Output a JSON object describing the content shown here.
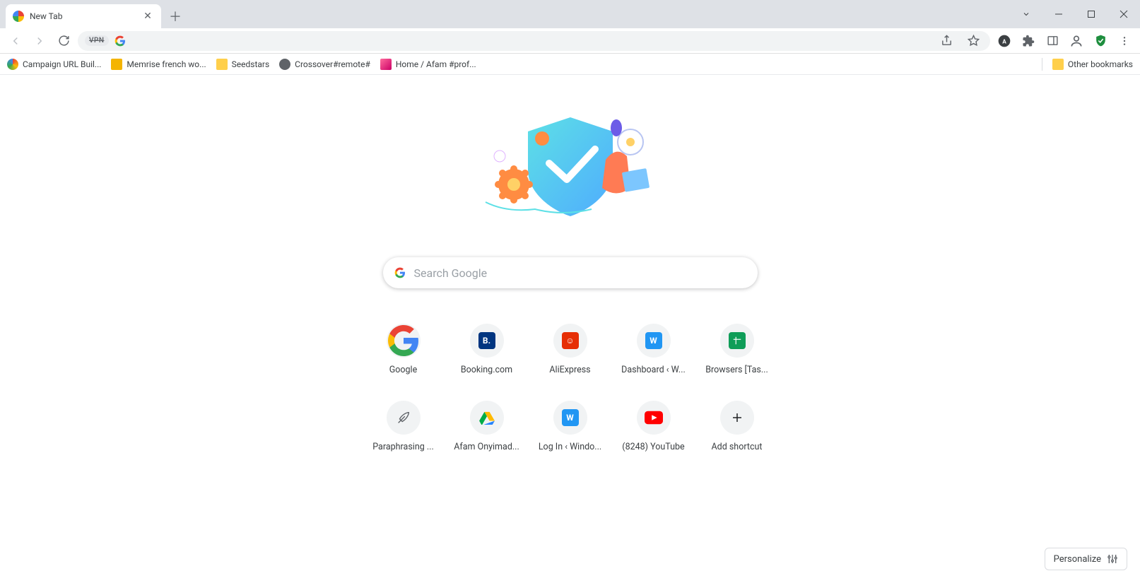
{
  "tab": {
    "title": "New Tab"
  },
  "omnibox": {
    "vpn_label": "VPN"
  },
  "bookmarks": {
    "items": [
      {
        "label": "Campaign URL Buil..."
      },
      {
        "label": "Memrise french wo..."
      },
      {
        "label": "Seedstars"
      },
      {
        "label": "Crossover#remote#"
      },
      {
        "label": "Home / Afam #prof..."
      }
    ],
    "other": "Other bookmarks"
  },
  "search": {
    "placeholder": "Search Google"
  },
  "shortcuts": [
    {
      "label": "Google"
    },
    {
      "label": "Booking.com"
    },
    {
      "label": "AliExpress"
    },
    {
      "label": "Dashboard ‹ W..."
    },
    {
      "label": "Browsers [Tas..."
    },
    {
      "label": "Paraphrasing ..."
    },
    {
      "label": "Afam Onyimad..."
    },
    {
      "label": "Log In ‹ Windo..."
    },
    {
      "label": "(8248) YouTube"
    },
    {
      "label": "Add shortcut"
    }
  ],
  "personalize": {
    "label": "Personalize"
  }
}
